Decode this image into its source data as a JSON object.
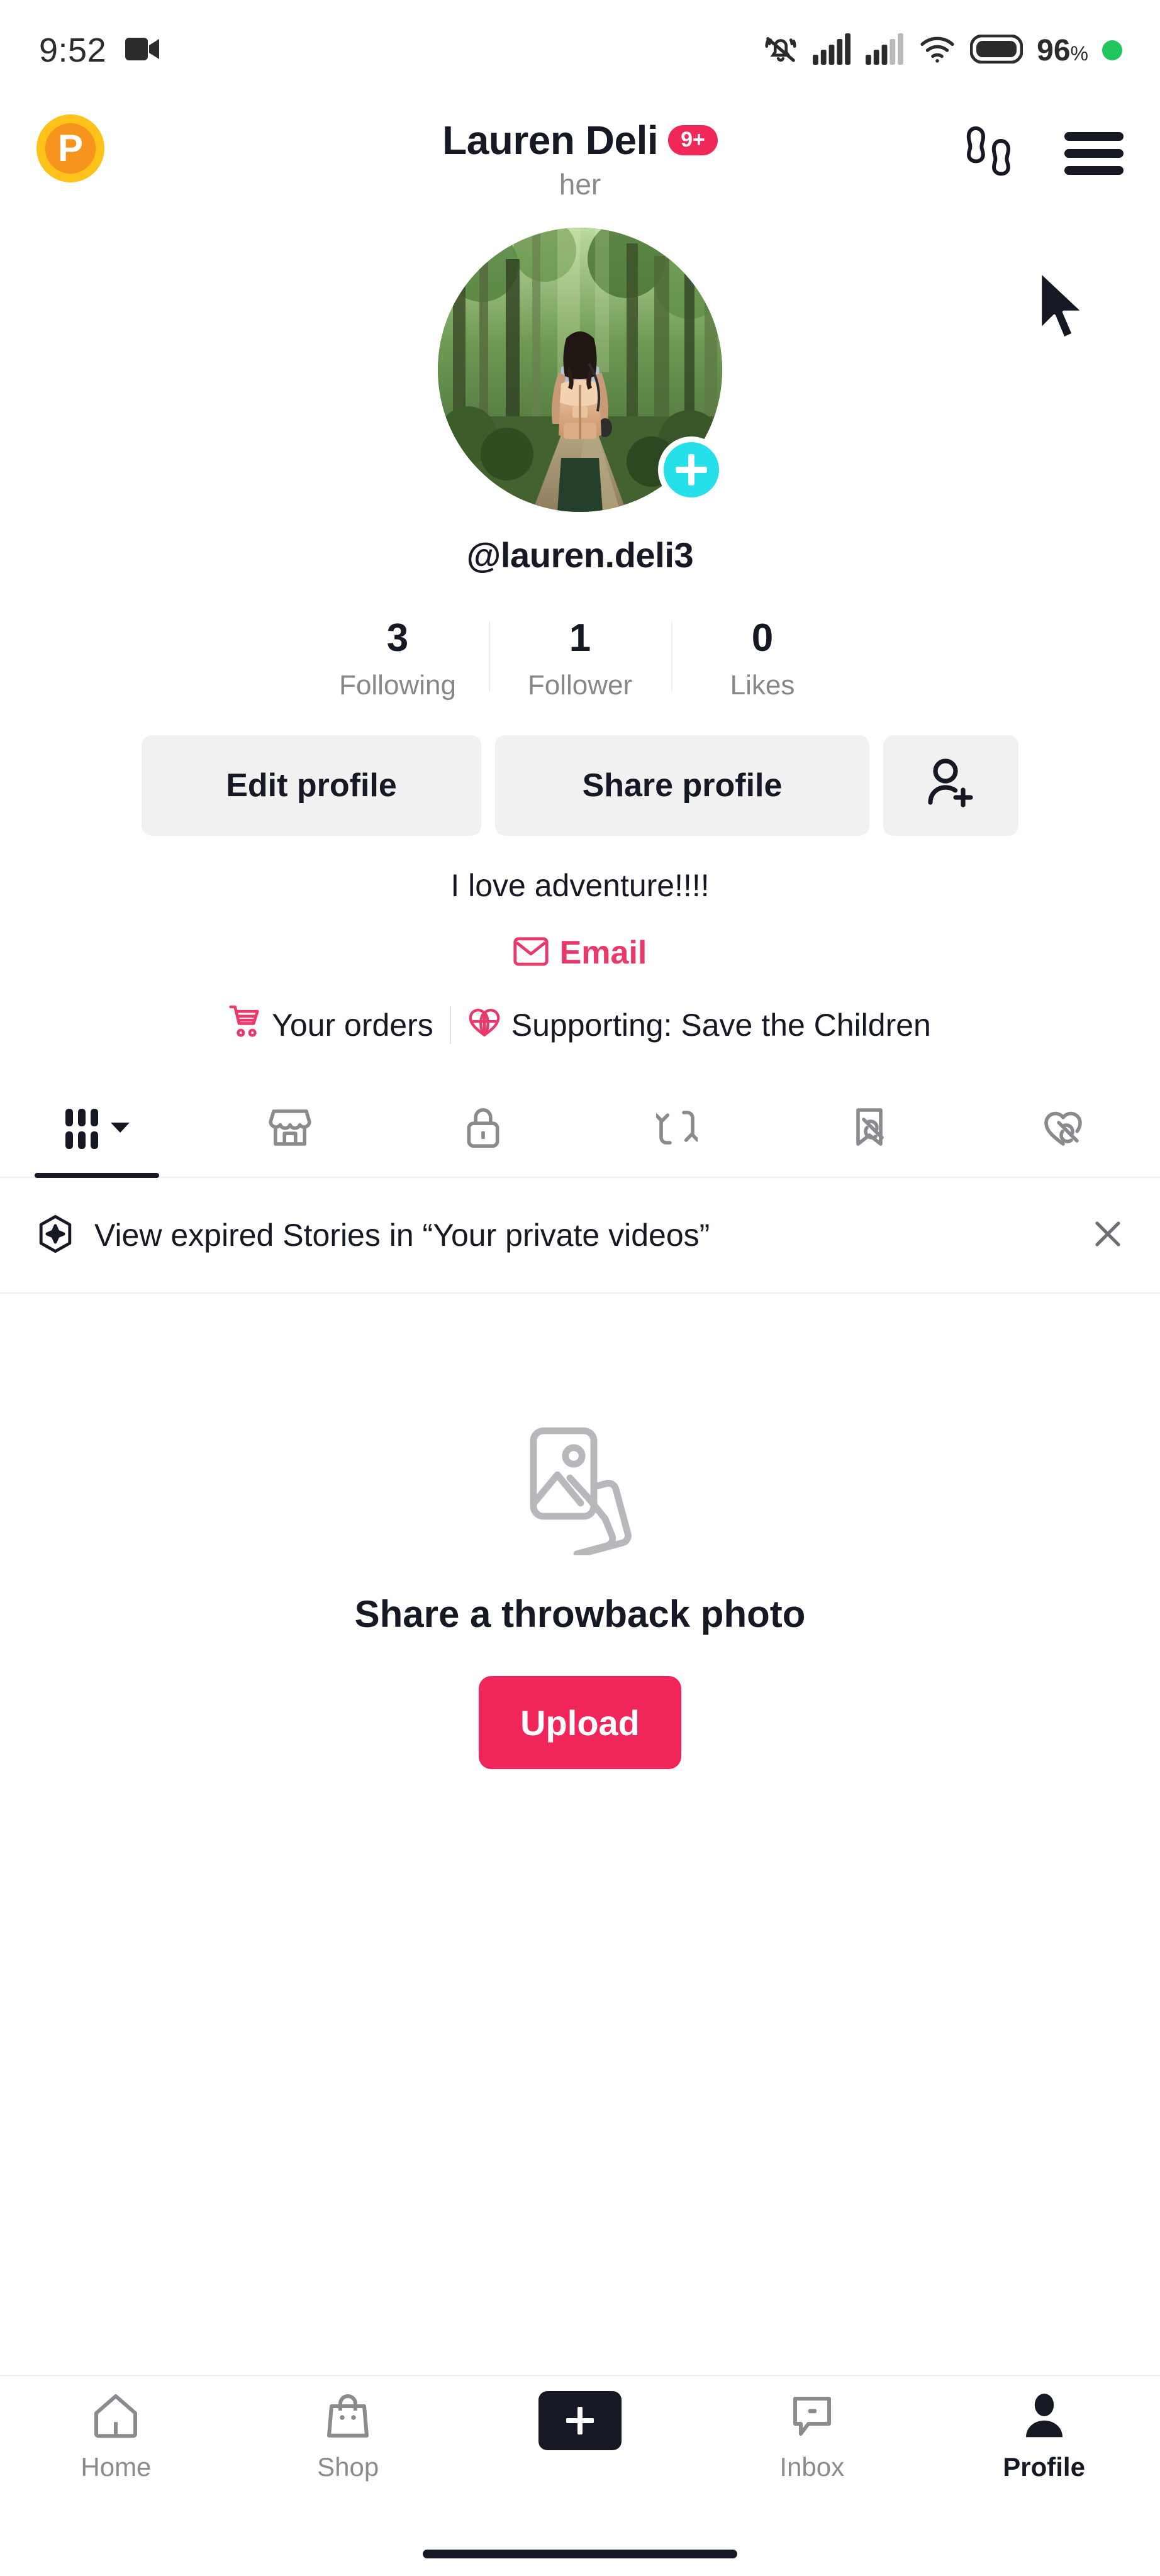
{
  "statusbar": {
    "time": "9:52",
    "icons": [
      "video-camera-icon",
      "bell-muted-icon",
      "signal-1-icon",
      "signal-2-icon",
      "wifi-icon",
      "battery-icon"
    ],
    "battery_percent": "96",
    "percent_symbol": "%"
  },
  "header": {
    "left_badge_letter": "P",
    "title": "Lauren Deli",
    "notification_badge": "9+",
    "pronoun": "her",
    "footprints_icon": "footprints-icon",
    "menu_icon": "hamburger-menu-icon"
  },
  "profile": {
    "avatar_alt": "woman with backpack on forest trail",
    "add_story_icon": "plus-icon",
    "username": "@lauren.deli3",
    "stats": [
      {
        "count": "3",
        "label": "Following"
      },
      {
        "count": "1",
        "label": "Follower"
      },
      {
        "count": "0",
        "label": "Likes"
      }
    ],
    "edit_profile_label": "Edit profile",
    "share_profile_label": "Share profile",
    "add_friends_icon": "person-add-icon",
    "bio": "I love adventure!!!!",
    "email_label": "Email",
    "email_icon": "envelope-icon",
    "your_orders_label": "Your orders",
    "orders_icon": "shopping-cart-icon",
    "supporting_label": "Supporting: Save the Children",
    "supporting_icon": "heart-globe-icon"
  },
  "tabs": [
    {
      "name": "videos-grid",
      "icon": "grid-icon",
      "active": true,
      "has_chevron": true
    },
    {
      "name": "shop",
      "icon": "storefront-icon",
      "active": false
    },
    {
      "name": "private",
      "icon": "lock-icon",
      "active": false
    },
    {
      "name": "reposts",
      "icon": "repost-arrows-icon",
      "active": false
    },
    {
      "name": "favorites",
      "icon": "bookmark-hidden-icon",
      "active": false
    },
    {
      "name": "liked",
      "icon": "heart-hidden-icon",
      "active": false
    }
  ],
  "banner": {
    "icon": "sparkle-circle-icon",
    "text": "View expired Stories in “Your private videos”",
    "close_icon": "close-icon"
  },
  "empty_state": {
    "icon": "photo-stack-icon",
    "title": "Share a throwback photo",
    "button_label": "Upload"
  },
  "bottomnav": [
    {
      "label": "Home",
      "icon": "home-icon",
      "active": false
    },
    {
      "label": "Shop",
      "icon": "shopping-bag-icon",
      "active": false
    },
    {
      "label": "",
      "icon": "create-plus-icon",
      "active": false
    },
    {
      "label": "Inbox",
      "icon": "message-bubble-icon",
      "active": false
    },
    {
      "label": "Profile",
      "icon": "person-filled-icon",
      "active": true
    }
  ],
  "colors": {
    "accent_pink": "#F0265A",
    "badge_pink": "#F0285A",
    "email_pink": "#E8396A",
    "cyan": "#25F4EE",
    "story_plus_cyan": "#25E0E8",
    "gold": "#FFC21A",
    "orange": "#F7941E",
    "text": "#161823",
    "muted": "#86878b",
    "grey_button": "#f1f1f2"
  }
}
